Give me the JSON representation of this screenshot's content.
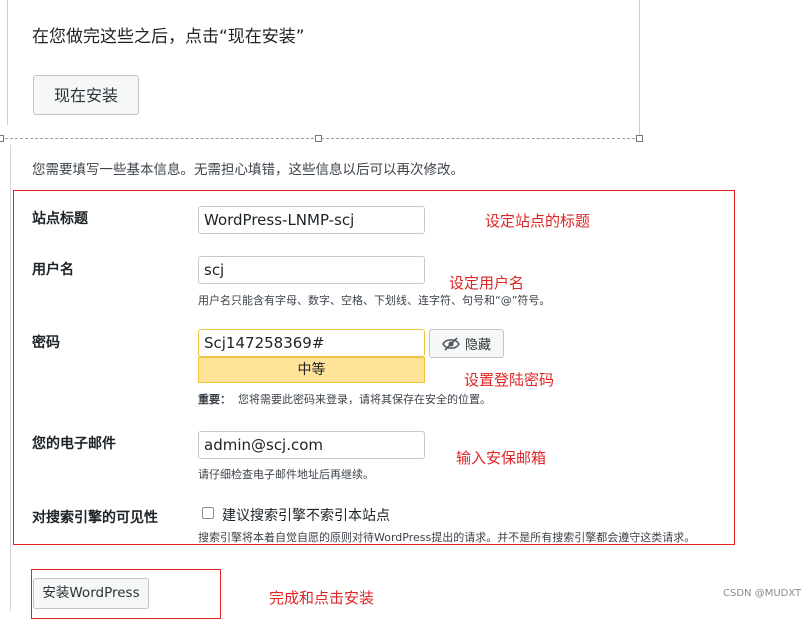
{
  "top": {
    "intro": "在您做完这些之后，点击“现在安装”",
    "install_now_label": "现在安装"
  },
  "info_text": "您需要填写一些基本信息。无需担心填错，这些信息以后可以再次修改。",
  "form": {
    "site_title": {
      "label": "站点标题",
      "value": "WordPress-LNMP-scj",
      "annotation": "设定站点的标题"
    },
    "username": {
      "label": "用户名",
      "value": "scj",
      "hint": "用户名只能含有字母、数字、空格、下划线、连字符、句号和“@”符号。",
      "annotation": "设定用户名"
    },
    "password": {
      "label": "密码",
      "value": "Scj147258369#",
      "hide_label": "隐藏",
      "strength": "中等",
      "note_bold": "重要：",
      "note": "您将需要此密码来登录，请将其保存在安全的位置。",
      "annotation": "设置登陆密码"
    },
    "email": {
      "label": "您的电子邮件",
      "value": "admin@scj.com",
      "hint": "请仔细检查电子邮件地址后再继续。",
      "annotation": "输入安保邮箱"
    },
    "visibility": {
      "label": "对搜索引擎的可见性",
      "checkbox_label": "建议搜索引擎不索引本站点",
      "checked": false,
      "hint": "搜索引擎将本着自觉自愿的原则对待WordPress提出的请求。并不是所有搜索引擎都会遵守这类请求。"
    }
  },
  "install_wp_label": "安装WordPress",
  "install_annotation": "完成和点击安装",
  "watermark": "CSDN @MUDXT",
  "colors": {
    "annotation_red": "#e02424",
    "strength_bg": "#ffe399",
    "strength_border": "#f0c33c"
  }
}
